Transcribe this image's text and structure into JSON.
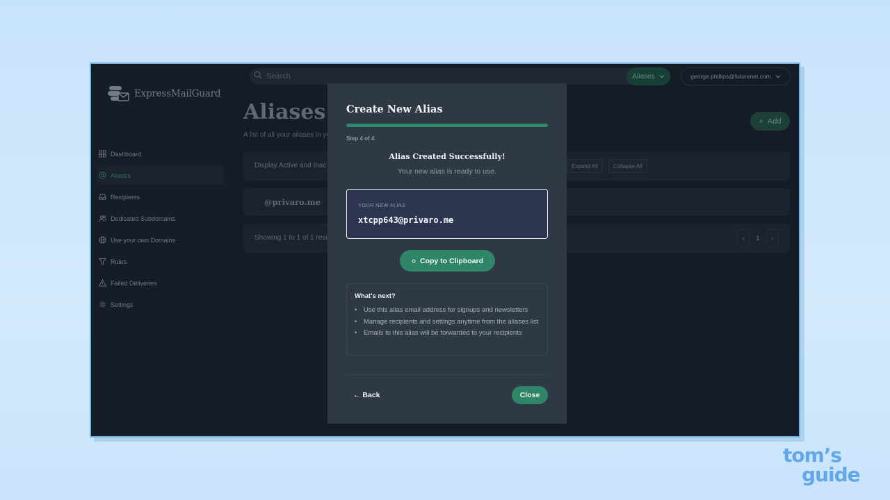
{
  "app": {
    "brand": "ExpressMailGuard",
    "search_placeholder": "Search",
    "section_button": "Aliases",
    "user_email": "george.phillips@futurenet.com"
  },
  "sidebar": {
    "items": [
      {
        "label": "Dashboard",
        "icon": "grid-icon"
      },
      {
        "label": "Aliases",
        "icon": "at-icon",
        "active": true
      },
      {
        "label": "Recipients",
        "icon": "inbox-icon"
      },
      {
        "label": "Dedicated Subdomains",
        "icon": "users-icon"
      },
      {
        "label": "Use your own Domains",
        "icon": "globe-icon"
      },
      {
        "label": "Rules",
        "icon": "filter-icon"
      },
      {
        "label": "Failed Deliveries",
        "icon": "warning-icon"
      },
      {
        "label": "Settings",
        "icon": "gear-icon"
      }
    ]
  },
  "main": {
    "title": "Aliases",
    "subtitle": "A list of all your aliases in yo",
    "add_label": "Add",
    "filter_text": "Display Active and Inac",
    "expand_all": "Expand All",
    "collapse_all": "Collapse All",
    "alias_domain": "@privaro.me",
    "showing_text": "Showing 1 to 1 of 1 resu",
    "page_number": "1"
  },
  "modal": {
    "title": "Create New Alias",
    "progress": 1.0,
    "step_text": "Step 4 of 4",
    "success_title": "Alias Created Successfully!",
    "success_sub": "Your new alias is ready to use.",
    "alias_label": "YOUR NEW ALIAS",
    "alias_value": "xtcpp643@privaro.me",
    "copy_button": "Copy to Clipboard",
    "whats_next_title": "What's next?",
    "whats_next": [
      "Use this alias email address for signups and newsletters",
      "Manage recipients and settings anytime from the aliases list",
      "Emails to this alias will be forwarded to your recipients"
    ],
    "back_button": "← Back",
    "close_button": "Close"
  },
  "watermark": {
    "line1": "tom’s",
    "line2": "guide"
  },
  "colors": {
    "accent": "#2f8567",
    "background": "#1a212c",
    "modal": "#2f3946"
  }
}
